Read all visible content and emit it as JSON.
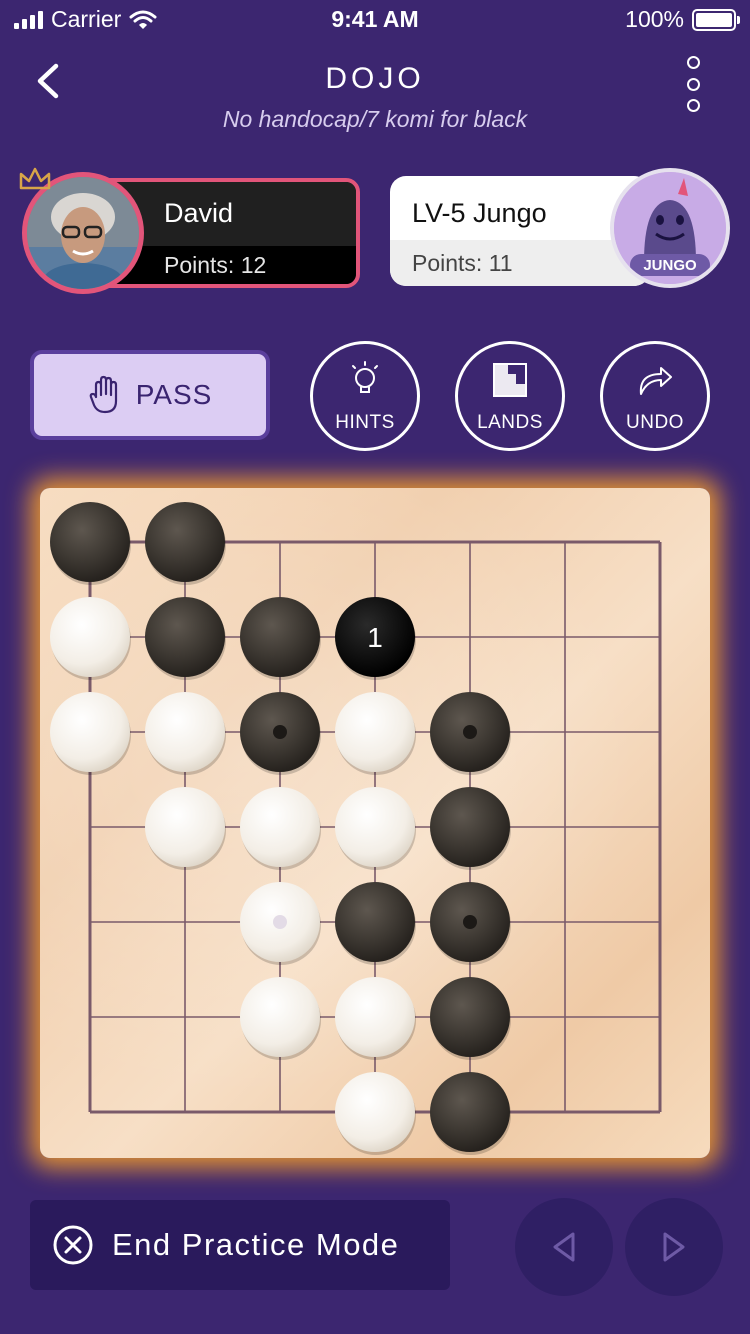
{
  "status_bar": {
    "carrier": "Carrier",
    "time": "9:41 AM",
    "battery": "100%"
  },
  "header": {
    "title": "DOJO",
    "subtitle": "No handocap/7 komi for black"
  },
  "player1": {
    "name": "David",
    "points": "Points: 12",
    "accent": "#e2557a"
  },
  "player2": {
    "name": "LV-5 Jungo",
    "points": "Points: 11",
    "avatar_label": "JUNGO"
  },
  "actions": {
    "pass": "PASS",
    "hints": "HINTS",
    "lands": "LANDS",
    "undo": "UNDO"
  },
  "board": {
    "size": 7,
    "last_move_label": "1",
    "stones": [
      {
        "row": 0,
        "col": 0,
        "color": "black"
      },
      {
        "row": 0,
        "col": 1,
        "color": "black"
      },
      {
        "row": 1,
        "col": 0,
        "color": "white"
      },
      {
        "row": 1,
        "col": 1,
        "color": "black"
      },
      {
        "row": 1,
        "col": 2,
        "color": "black"
      },
      {
        "row": 1,
        "col": 3,
        "color": "black",
        "label": "1"
      },
      {
        "row": 2,
        "col": 0,
        "color": "white"
      },
      {
        "row": 2,
        "col": 1,
        "color": "white"
      },
      {
        "row": 2,
        "col": 2,
        "color": "black",
        "marker": true
      },
      {
        "row": 2,
        "col": 3,
        "color": "white"
      },
      {
        "row": 2,
        "col": 4,
        "color": "black",
        "marker": true
      },
      {
        "row": 3,
        "col": 1,
        "color": "white"
      },
      {
        "row": 3,
        "col": 2,
        "color": "white"
      },
      {
        "row": 3,
        "col": 3,
        "color": "white"
      },
      {
        "row": 3,
        "col": 4,
        "color": "black"
      },
      {
        "row": 4,
        "col": 2,
        "color": "white",
        "marker": true
      },
      {
        "row": 4,
        "col": 3,
        "color": "black"
      },
      {
        "row": 4,
        "col": 4,
        "color": "black",
        "marker": true
      },
      {
        "row": 5,
        "col": 2,
        "color": "white"
      },
      {
        "row": 5,
        "col": 3,
        "color": "white"
      },
      {
        "row": 5,
        "col": 4,
        "color": "black"
      },
      {
        "row": 6,
        "col": 3,
        "color": "white"
      },
      {
        "row": 6,
        "col": 4,
        "color": "black"
      }
    ]
  },
  "bottom": {
    "end_practice": "End Practice Mode"
  },
  "colors": {
    "background": "#3c2670",
    "glow": "#ffa428",
    "pass_bg": "#dccdf3"
  }
}
